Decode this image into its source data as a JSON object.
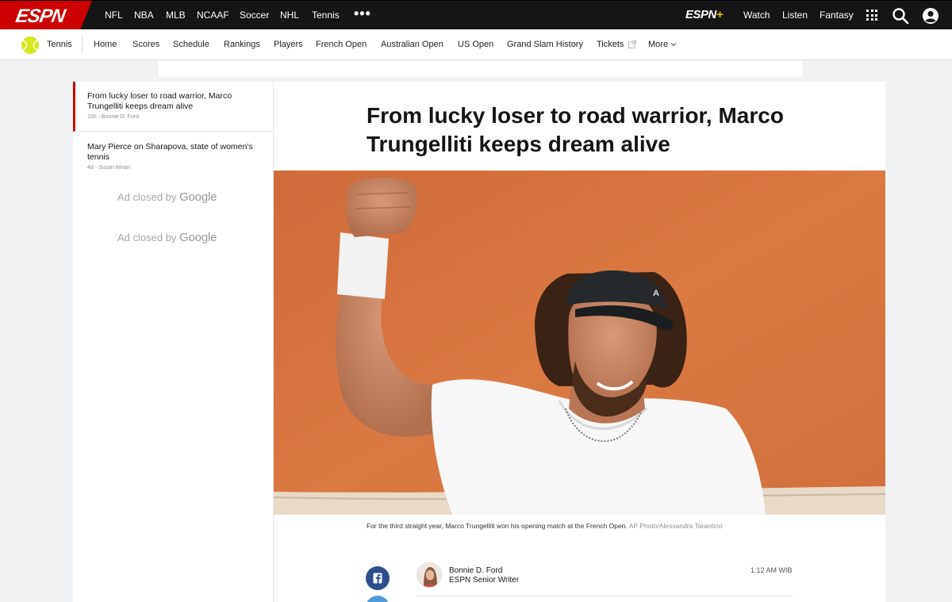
{
  "global_nav": {
    "logo": "ESPN",
    "links": [
      "NFL",
      "NBA",
      "MLB",
      "NCAAF",
      "Soccer",
      "NHL",
      "Tennis"
    ],
    "more": "•••",
    "espn_plus_logo": "ESPN",
    "espn_plus_mark": "+",
    "right_links": [
      "Watch",
      "Listen",
      "Fantasy"
    ],
    "icons": [
      "apps-grid-icon",
      "search-icon",
      "user-icon"
    ]
  },
  "sub_nav": {
    "sport": "Tennis",
    "links": [
      "Home",
      "Scores",
      "Schedule",
      "Rankings",
      "Players",
      "French Open",
      "Australian Open",
      "US Open",
      "Grand Slam History",
      "Tickets",
      "More"
    ]
  },
  "sidebar": {
    "stories": [
      {
        "title": "From lucky loser to road warrior, Marco Trungelliti keeps dream alive",
        "meta": "15h - Bonnie D. Ford"
      },
      {
        "title": "Mary Pierce on Sharapova, state of women's tennis",
        "meta": "4d - Susan Ninan"
      }
    ],
    "ads": [
      {
        "text": "Ad closed by",
        "brand": "Google"
      },
      {
        "text": "Ad closed by",
        "brand": "Google"
      }
    ]
  },
  "article": {
    "headline": "From lucky loser to road warrior, Marco Trungelliti keeps dream alive",
    "caption": "For the third straight year, Marco Trungelliti won his opening match at the French Open.",
    "credit": "AP Photo/Alessandra Tarantino",
    "author_name": "Bonnie D. Ford",
    "author_title": "ESPN Senior Writer",
    "timestamp": "1:12 AM WIB"
  },
  "colors": {
    "espn_red": "#cc0000",
    "nav_bg": "#151515",
    "clay": "#d9713c",
    "facebook": "#2d4e8c",
    "twitter": "#4f9ad8"
  }
}
